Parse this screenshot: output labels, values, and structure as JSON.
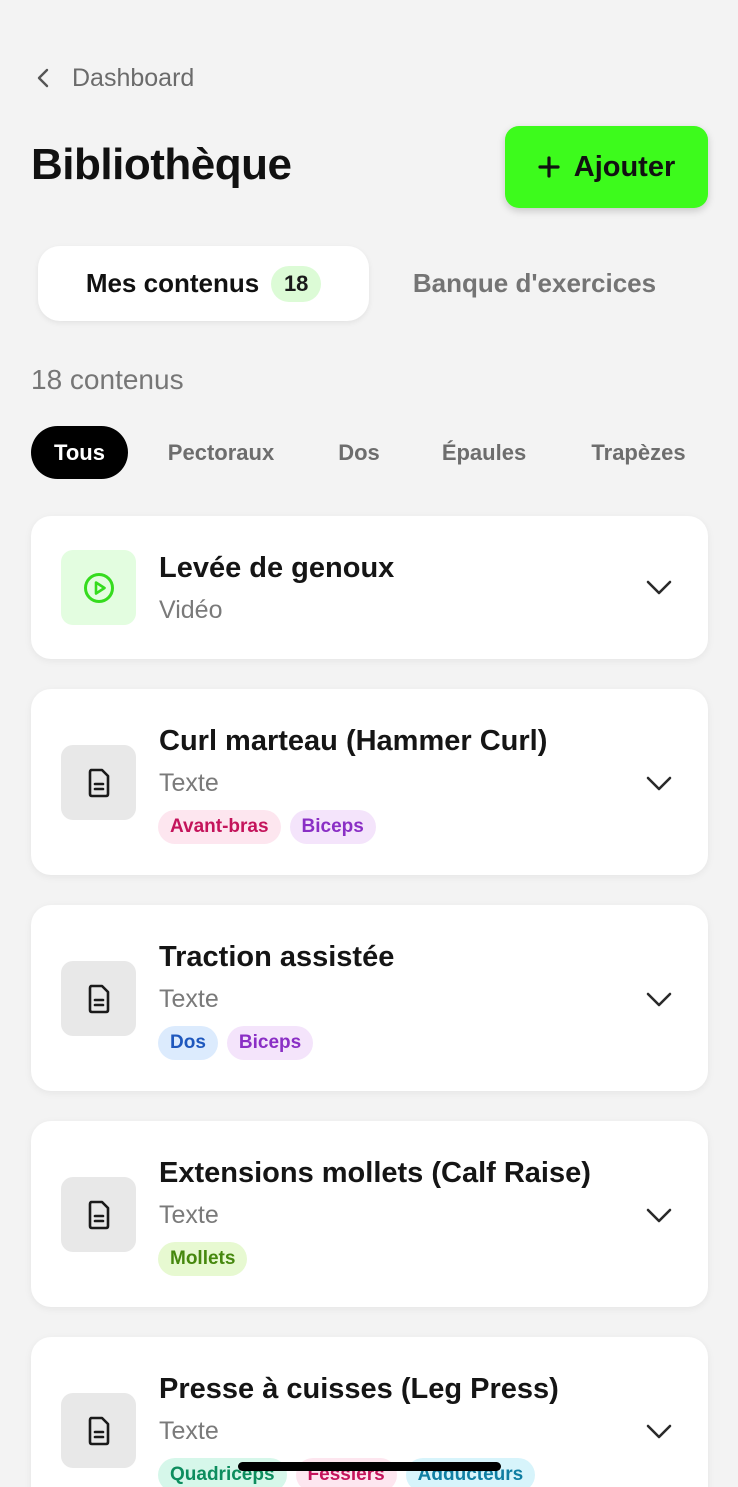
{
  "nav": {
    "back_label": "Dashboard"
  },
  "header": {
    "title": "Bibliothèque",
    "add_label": "Ajouter"
  },
  "tabs": {
    "active": {
      "label": "Mes contenus",
      "count": "18"
    },
    "inactive": {
      "label": "Banque d'exercices"
    }
  },
  "content_count": "18 contenus",
  "filters": [
    "Tous",
    "Pectoraux",
    "Dos",
    "Épaules",
    "Trapèzes"
  ],
  "items": [
    {
      "title": "Levée de genoux",
      "type": "Vidéo",
      "icon": "play-circle-icon",
      "tags": []
    },
    {
      "title": "Curl marteau (Hammer Curl)",
      "type": "Texte",
      "icon": "document-icon",
      "tags": [
        "Avant-bras",
        "Biceps"
      ]
    },
    {
      "title": "Traction assistée",
      "type": "Texte",
      "icon": "document-icon",
      "tags": [
        "Dos",
        "Biceps"
      ]
    },
    {
      "title": "Extensions mollets (Calf Raise)",
      "type": "Texte",
      "icon": "document-icon",
      "tags": [
        "Mollets"
      ]
    },
    {
      "title": "Presse à cuisses (Leg Press)",
      "type": "Texte",
      "icon": "document-icon",
      "tags": [
        "Quadriceps",
        "Fessiers",
        "Adducteurs"
      ]
    }
  ],
  "colors": {
    "accent": "#3dfb1c",
    "background": "#f3f3f3",
    "tag_pink": "#c4145b",
    "tag_purple": "#8a2fc5",
    "tag_blue": "#1f58bd",
    "tag_green": "#46880e",
    "tag_teal": "#0d8d5e",
    "tag_cyan": "#0f7ea2"
  }
}
